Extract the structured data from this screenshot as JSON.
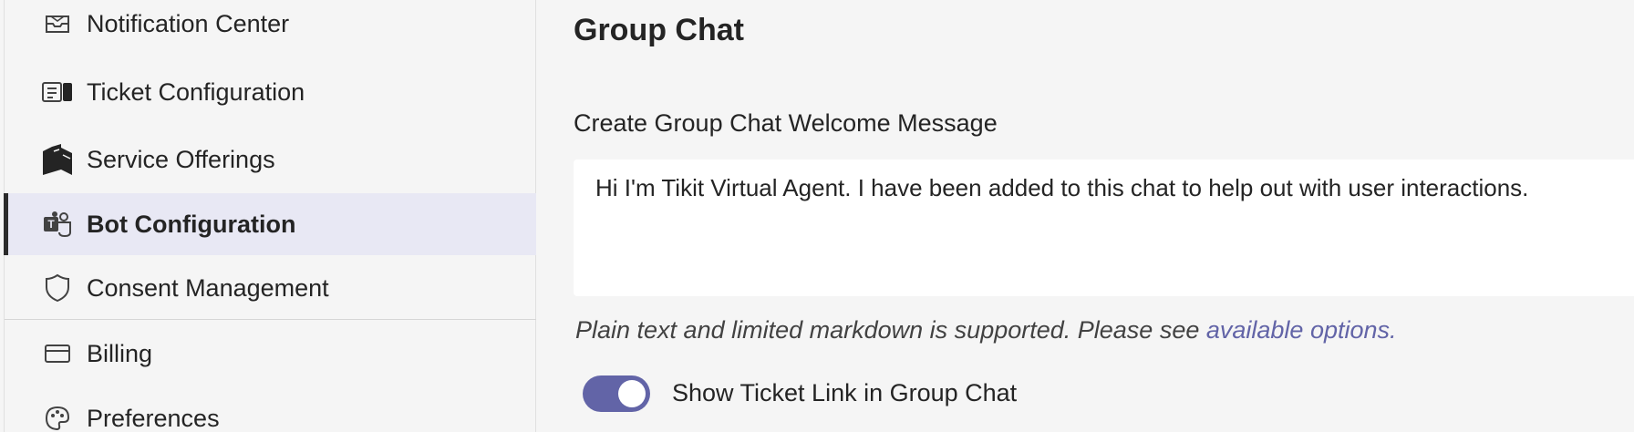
{
  "sidebar": {
    "items": [
      {
        "label": "Notification Center",
        "icon": "notification-center-icon"
      },
      {
        "label": "Ticket Configuration",
        "icon": "ticket-configuration-icon"
      },
      {
        "label": "Service Offerings",
        "icon": "service-offerings-icon"
      },
      {
        "label": "Bot Configuration",
        "icon": "bot-configuration-icon",
        "active": true
      },
      {
        "label": "Consent Management",
        "icon": "shield-icon"
      },
      {
        "label": "Billing",
        "icon": "billing-icon"
      },
      {
        "label": "Preferences",
        "icon": "palette-icon"
      }
    ]
  },
  "main": {
    "section_title": "Group Chat",
    "welcome_label": "Create Group Chat Welcome Message",
    "welcome_value": "Hi I'm Tikit Virtual Agent. I have been added to this chat to help out with user interactions.",
    "help_text": "Plain text and limited markdown is supported. Please see ",
    "help_link": "available options.",
    "toggle_label": "Show Ticket Link in Group Chat",
    "toggle_on": true
  },
  "colors": {
    "accent": "#6264a7",
    "active_bg": "#e8e8f4",
    "background": "#f5f5f5"
  }
}
